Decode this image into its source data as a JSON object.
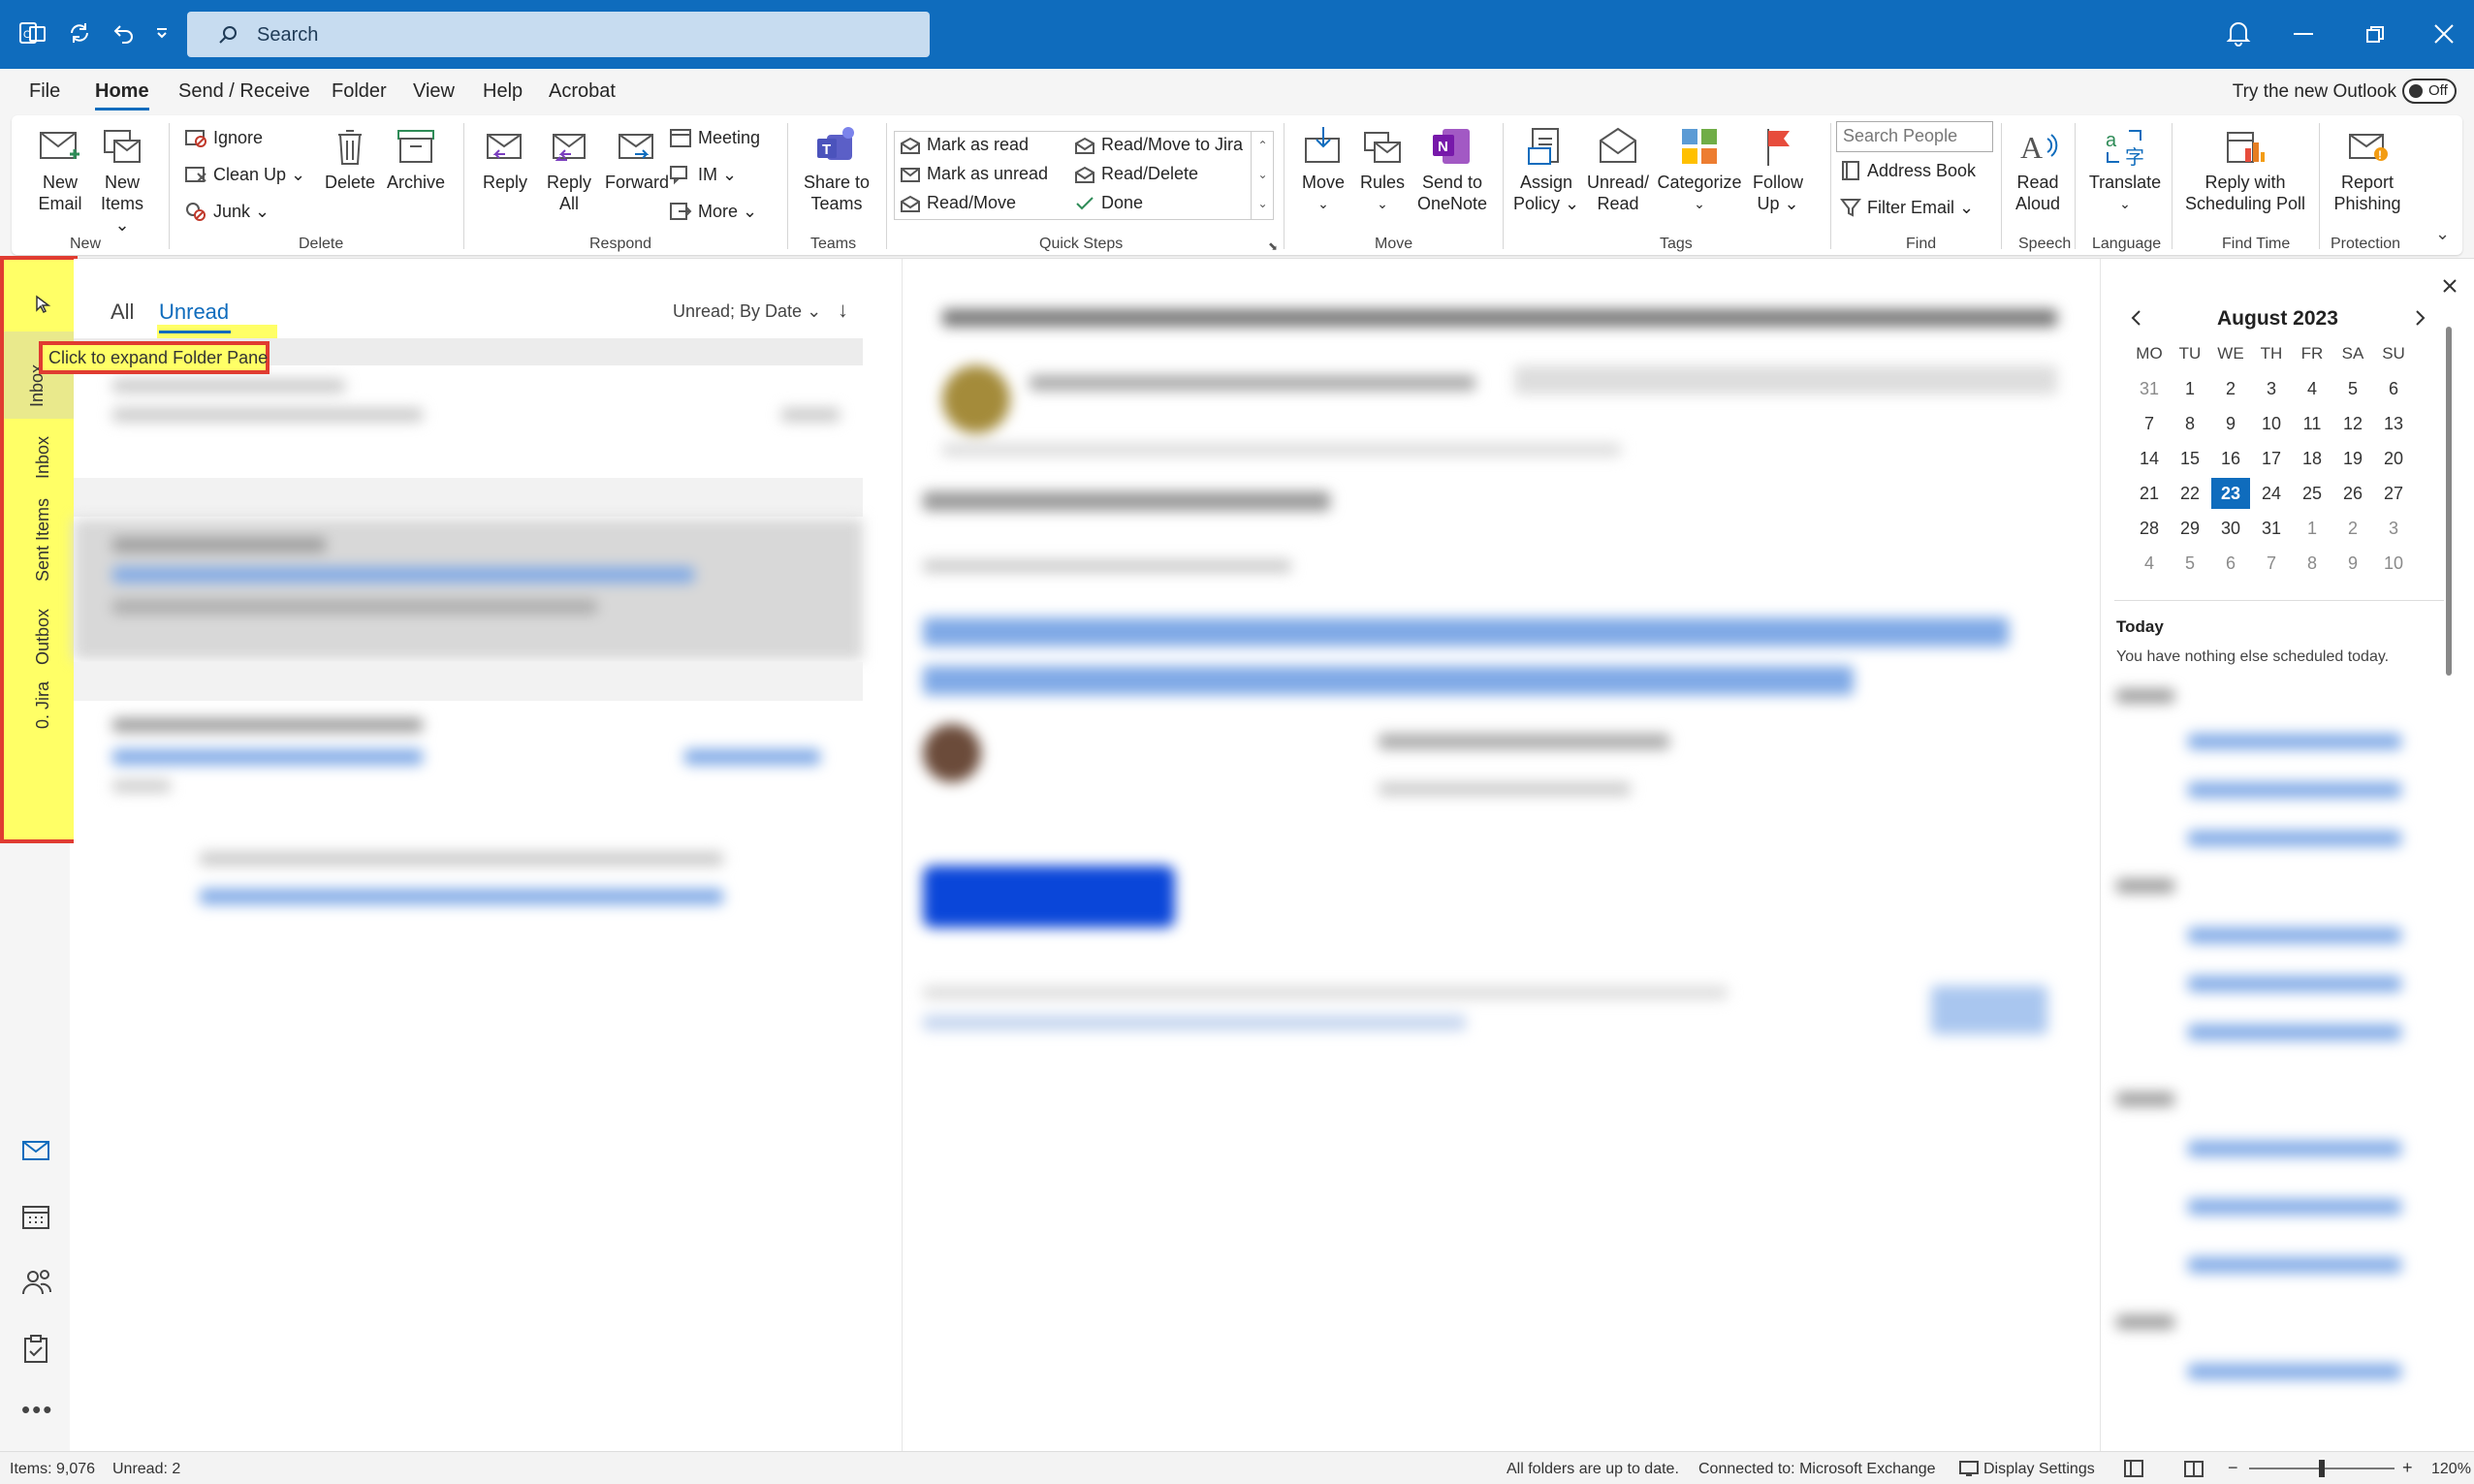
{
  "titlebar": {
    "search_placeholder": "Search"
  },
  "menu": {
    "tabs": [
      "File",
      "Home",
      "Send / Receive",
      "Folder",
      "View",
      "Help",
      "Acrobat"
    ],
    "active": "Home",
    "try_new": "Try the new Outlook",
    "toggle_label": "Off"
  },
  "ribbon": {
    "new": {
      "new_email": [
        "New",
        "Email"
      ],
      "new_items": [
        "New",
        "Items ⌄"
      ],
      "label": "New"
    },
    "delete": {
      "ignore": "Ignore",
      "cleanup": "Clean Up ⌄",
      "junk": "Junk ⌄",
      "delete": "Delete",
      "archive": "Archive",
      "label": "Delete"
    },
    "respond": {
      "reply": "Reply",
      "reply_all": [
        "Reply",
        "All"
      ],
      "forward": "Forward",
      "meeting": "Meeting",
      "im": "IM ⌄",
      "more": "More ⌄",
      "label": "Respond"
    },
    "teams": {
      "share": [
        "Share to",
        "Teams"
      ],
      "label": "Teams"
    },
    "quicksteps": {
      "items": [
        "Mark as read",
        "Mark as unread",
        "Read/Move",
        "Read/Move to Jira",
        "Read/Delete",
        "Done"
      ],
      "label": "Quick Steps"
    },
    "move": {
      "move": "Move",
      "rules": "Rules",
      "onenote": [
        "Send to",
        "OneNote"
      ],
      "label": "Move"
    },
    "tags": {
      "assign": [
        "Assign",
        "Policy ⌄"
      ],
      "unread": [
        "Unread/",
        "Read"
      ],
      "categorize": "Categorize",
      "follow": [
        "Follow",
        "Up ⌄"
      ],
      "label": "Tags"
    },
    "find": {
      "search_people": "Search People",
      "address_book": "Address Book",
      "filter_email": "Filter Email ⌄",
      "label": "Find"
    },
    "speech": {
      "read_aloud": [
        "Read",
        "Aloud"
      ],
      "label": "Speech"
    },
    "language": {
      "translate": "Translate",
      "label": "Language"
    },
    "findtime": {
      "reply_poll": [
        "Reply with",
        "Scheduling Poll"
      ],
      "label": "Find Time"
    },
    "protection": {
      "report": [
        "Report",
        "Phishing"
      ],
      "label": "Protection"
    }
  },
  "folder_strip": {
    "folders": [
      "Inbox",
      "Inbox",
      "Sent Items",
      "Outbox",
      "0. Jira"
    ],
    "tooltip": "Click to expand Folder Pane"
  },
  "msglist": {
    "filter_all": "All",
    "filter_unread": "Unread",
    "sort": "Unread; By Date ⌄",
    "sort_arrow": "↓"
  },
  "calendar": {
    "month": "August 2023",
    "weekdays": [
      "MO",
      "TU",
      "WE",
      "TH",
      "FR",
      "SA",
      "SU"
    ],
    "weeks": [
      [
        "31",
        "1",
        "2",
        "3",
        "4",
        "5",
        "6"
      ],
      [
        "7",
        "8",
        "9",
        "10",
        "11",
        "12",
        "13"
      ],
      [
        "14",
        "15",
        "16",
        "17",
        "18",
        "19",
        "20"
      ],
      [
        "21",
        "22",
        "23",
        "24",
        "25",
        "26",
        "27"
      ],
      [
        "28",
        "29",
        "30",
        "31",
        "1",
        "2",
        "3"
      ],
      [
        "4",
        "5",
        "6",
        "7",
        "8",
        "9",
        "10"
      ]
    ],
    "today": "23",
    "today_label": "Today",
    "nothing": "You have nothing else scheduled today."
  },
  "statusbar": {
    "items": "Items: 9,076",
    "unread": "Unread: 2",
    "folders": "All folders are up to date.",
    "connected": "Connected to: Microsoft Exchange",
    "display": "Display Settings",
    "zoom": "120%"
  },
  "colors": {
    "accent": "#0f6cbd",
    "highlight": "#ffff66",
    "annotation": "#e03c31"
  }
}
